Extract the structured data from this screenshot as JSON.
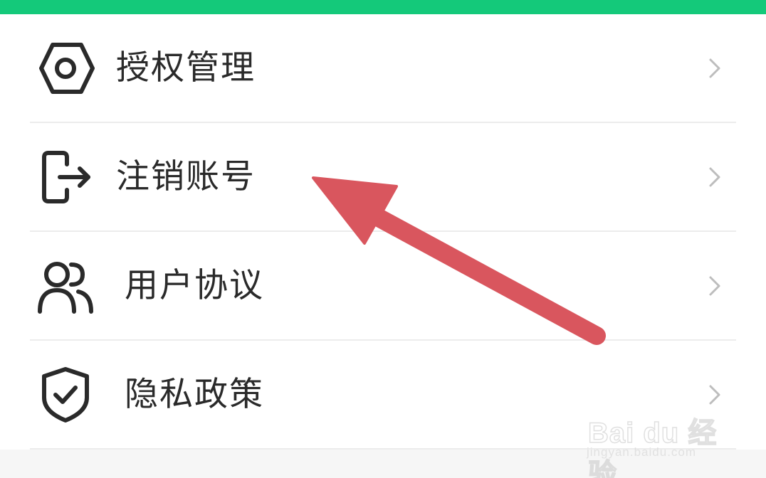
{
  "colors": {
    "accent": "#14c97a",
    "text": "#2a2a2a",
    "divider": "#ececec",
    "chevron": "#bdbdbd",
    "arrow": "#d9565e"
  },
  "settings": {
    "items": [
      {
        "label": "授权管理",
        "icon": "hexagon-settings-icon"
      },
      {
        "label": "注销账号",
        "icon": "logout-icon"
      },
      {
        "label": "用户协议",
        "icon": "users-icon"
      },
      {
        "label": "隐私政策",
        "icon": "shield-check-icon"
      }
    ]
  },
  "watermark": {
    "logo": "Bai du 经验",
    "url": "jingyan.baidu.com"
  }
}
